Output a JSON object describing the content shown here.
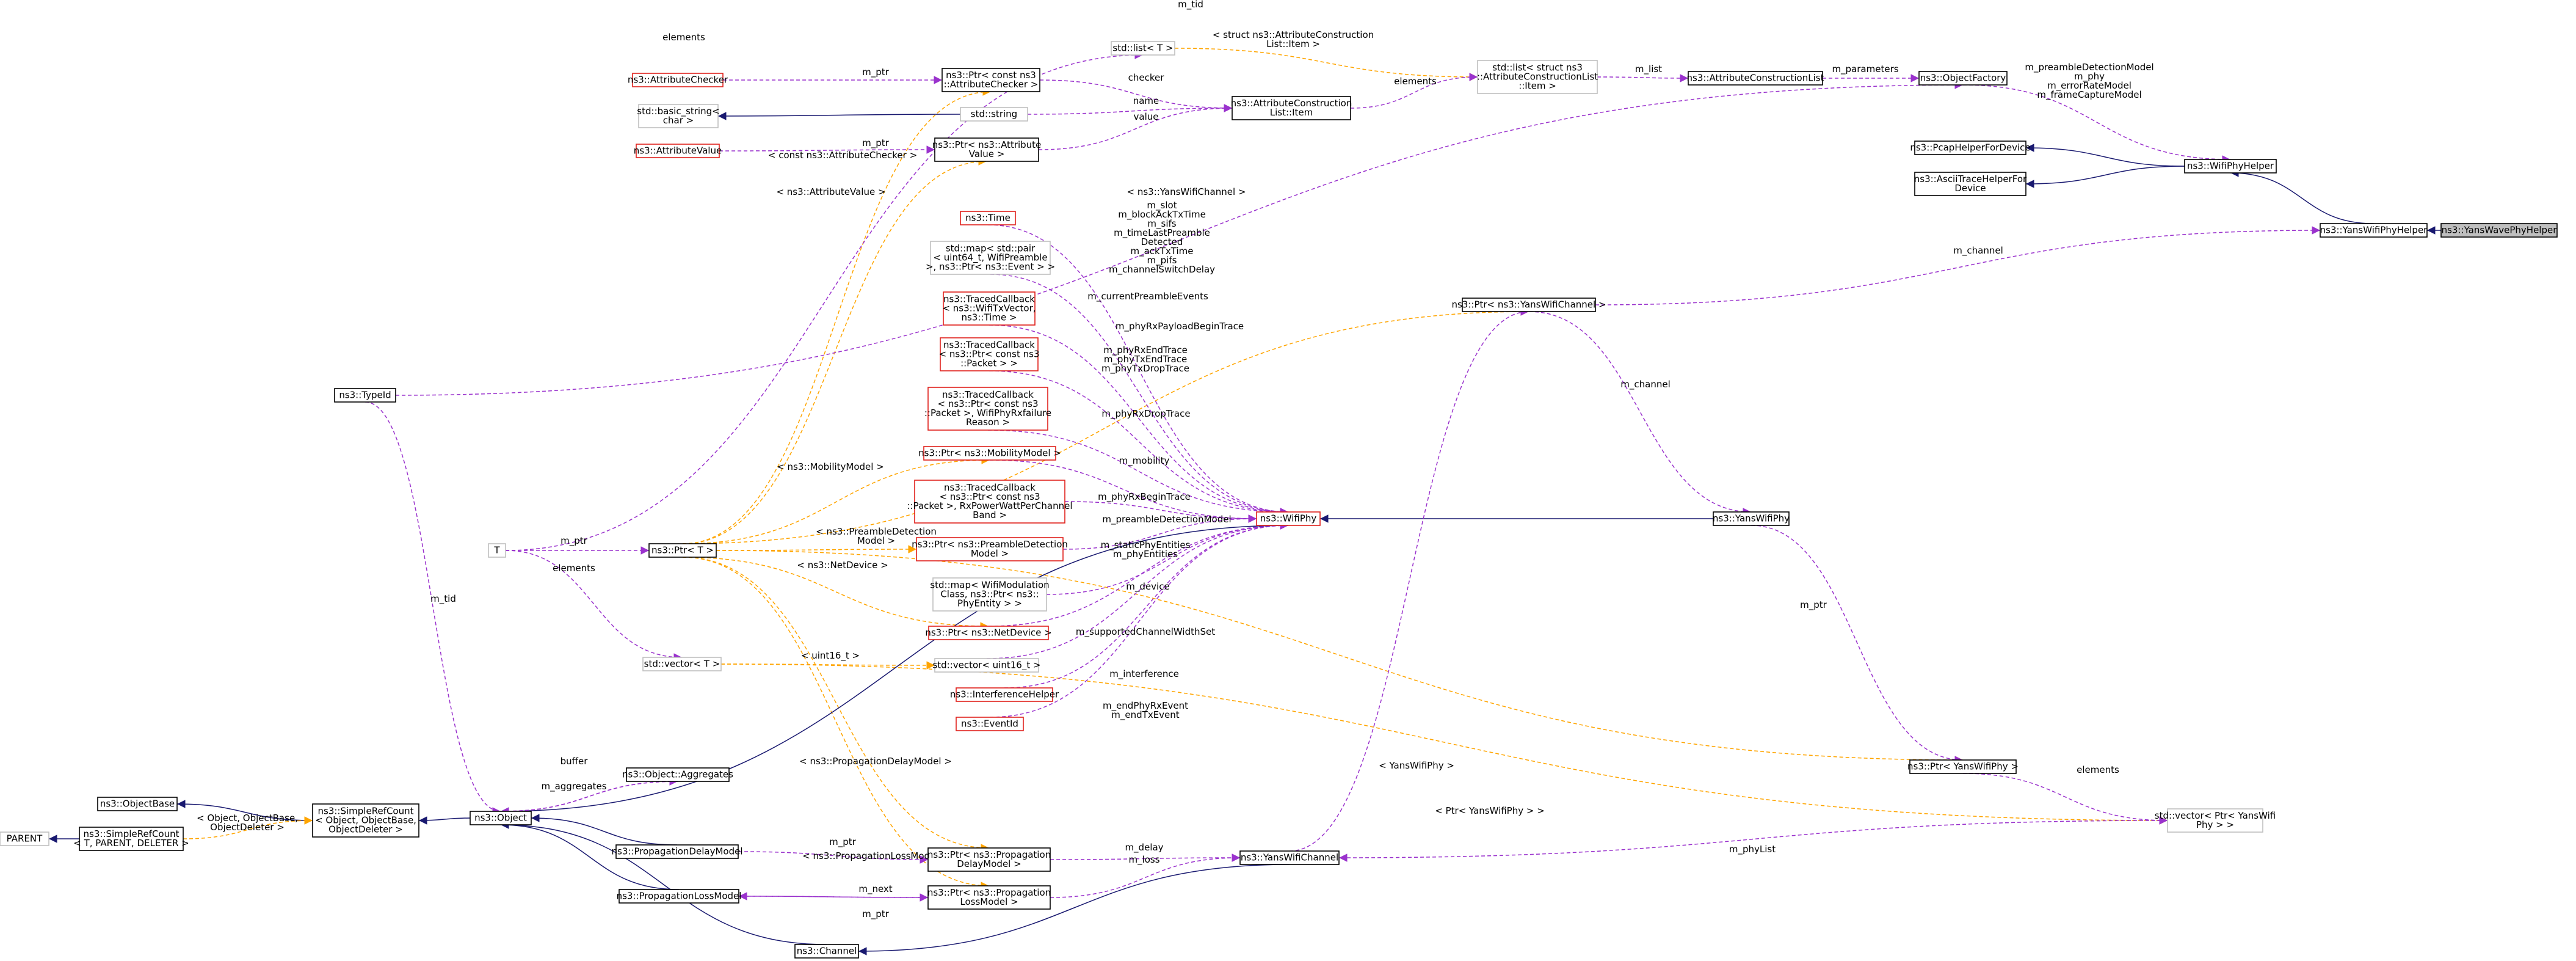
{
  "colors": {
    "inheritance": "#191970",
    "usage": "#9a32cd",
    "template": "#ffa500",
    "documented_border": "#000000",
    "undocumented_border": "#e0201b",
    "external_border": "#bfbfbf",
    "focus_fill": "#bfbfbf"
  },
  "nodes": [
    {
      "id": "focus",
      "lines": [
        "ns3::YansWavePhyHelper"
      ],
      "style": "focus"
    },
    {
      "id": "yanswifiphyhelper",
      "lines": [
        "ns3::YansWifiPhyHelper"
      ],
      "style": "black"
    },
    {
      "id": "wifiphyhelper",
      "lines": [
        "ns3::WifiPhyHelper"
      ],
      "style": "black"
    },
    {
      "id": "pcaphelper",
      "lines": [
        "ns3::PcapHelperForDevice"
      ],
      "style": "black"
    },
    {
      "id": "asciihelper",
      "lines": [
        "ns3::AsciiTraceHelperFor",
        "Device"
      ],
      "style": "black"
    },
    {
      "id": "objectfactory",
      "lines": [
        "ns3::ObjectFactory"
      ],
      "style": "black"
    },
    {
      "id": "attrlist",
      "lines": [
        "ns3::AttributeConstructionList"
      ],
      "style": "black"
    },
    {
      "id": "stdlistitem",
      "lines": [
        "std::list< struct ns3",
        "::AttributeConstructionList",
        "::Item >"
      ],
      "style": "gray"
    },
    {
      "id": "stdlistT",
      "lines": [
        "std::list< T >"
      ],
      "style": "gray"
    },
    {
      "id": "attritem",
      "lines": [
        "ns3::AttributeConstruction",
        "List::Item"
      ],
      "style": "black"
    },
    {
      "id": "ptrchecker",
      "lines": [
        "ns3::Ptr< const ns3",
        "::AttributeChecker >"
      ],
      "style": "black"
    },
    {
      "id": "attrchecker",
      "lines": [
        "ns3::AttributeChecker"
      ],
      "style": "red"
    },
    {
      "id": "stdstring",
      "lines": [
        "std::string"
      ],
      "style": "gray"
    },
    {
      "id": "basicstring",
      "lines": [
        "std::basic_string<",
        "char >"
      ],
      "style": "gray"
    },
    {
      "id": "ptrattrvalue",
      "lines": [
        "ns3::Ptr< ns3::Attribute",
        "Value >"
      ],
      "style": "black"
    },
    {
      "id": "attrvalue",
      "lines": [
        "ns3::AttributeValue"
      ],
      "style": "red"
    },
    {
      "id": "typeid",
      "lines": [
        "ns3::TypeId"
      ],
      "style": "black"
    },
    {
      "id": "T",
      "lines": [
        "T"
      ],
      "style": "gray"
    },
    {
      "id": "ptrT",
      "lines": [
        "ns3::Ptr< T >"
      ],
      "style": "black"
    },
    {
      "id": "time",
      "lines": [
        "ns3::Time"
      ],
      "style": "red"
    },
    {
      "id": "stdmap1",
      "lines": [
        "std::map< std::pair",
        "< uint64_t, WifiPreamble",
        ">, ns3::Ptr< ns3::Event > >"
      ],
      "style": "gray"
    },
    {
      "id": "tc1",
      "lines": [
        "ns3::TracedCallback",
        "< ns3::WifiTxVector,",
        "ns3::Time >"
      ],
      "style": "red"
    },
    {
      "id": "tc2",
      "lines": [
        "ns3::TracedCallback",
        "< ns3::Ptr< const ns3",
        "::Packet > >"
      ],
      "style": "red"
    },
    {
      "id": "tc3",
      "lines": [
        "ns3::TracedCallback",
        "< ns3::Ptr< const ns3",
        "::Packet >, WifiPhyRxfailure",
        "Reason >"
      ],
      "style": "red"
    },
    {
      "id": "ptrmobility",
      "lines": [
        "ns3::Ptr< ns3::MobilityModel >"
      ],
      "style": "red"
    },
    {
      "id": "tc4",
      "lines": [
        "ns3::TracedCallback",
        "< ns3::Ptr< const ns3",
        "::Packet >, RxPowerWattPerChannel",
        "Band >"
      ],
      "style": "red"
    },
    {
      "id": "ptrpreamble",
      "lines": [
        "ns3::Ptr< ns3::PreambleDetection",
        "Model >"
      ],
      "style": "red"
    },
    {
      "id": "stdmap2",
      "lines": [
        "std::map< WifiModulation",
        "Class, ns3::Ptr< ns3::",
        "PhyEntity > >"
      ],
      "style": "gray"
    },
    {
      "id": "ptrnetdevice",
      "lines": [
        "ns3::Ptr< ns3::NetDevice >"
      ],
      "style": "red"
    },
    {
      "id": "vecuint16",
      "lines": [
        "std::vector< uint16_t >"
      ],
      "style": "gray"
    },
    {
      "id": "interference",
      "lines": [
        "ns3::InterferenceHelper"
      ],
      "style": "red"
    },
    {
      "id": "eventid",
      "lines": [
        "ns3::EventId"
      ],
      "style": "red"
    },
    {
      "id": "wifiphy",
      "lines": [
        "ns3::WifiPhy"
      ],
      "style": "red"
    },
    {
      "id": "yanswifiphy",
      "lines": [
        "ns3::YansWifiPhy"
      ],
      "style": "black"
    },
    {
      "id": "ptryanschannel",
      "lines": [
        "ns3::Ptr< ns3::YansWifiChannel >"
      ],
      "style": "black"
    },
    {
      "id": "ptryansphy",
      "lines": [
        "ns3::Ptr< YansWifiPhy >"
      ],
      "style": "black"
    },
    {
      "id": "vecptryans",
      "lines": [
        "std::vector< Ptr< YansWifi",
        "Phy > >"
      ],
      "style": "gray"
    },
    {
      "id": "stdvectorT",
      "lines": [
        "std::vector< T >"
      ],
      "style": "gray"
    },
    {
      "id": "aggregates",
      "lines": [
        "ns3::Object::Aggregates"
      ],
      "style": "black"
    },
    {
      "id": "objectbase",
      "lines": [
        "ns3::ObjectBase"
      ],
      "style": "black"
    },
    {
      "id": "simplerefcount",
      "lines": [
        "ns3::SimpleRefCount",
        "< Object, ObjectBase,",
        "ObjectDeleter >"
      ],
      "style": "black"
    },
    {
      "id": "simplerefcountT",
      "lines": [
        "ns3::SimpleRefCount",
        "< T, PARENT, DELETER >"
      ],
      "style": "black"
    },
    {
      "id": "parent",
      "lines": [
        "PARENT"
      ],
      "style": "gray"
    },
    {
      "id": "object",
      "lines": [
        "ns3::Object"
      ],
      "style": "black"
    },
    {
      "id": "propdelay",
      "lines": [
        "ns3::PropagationDelayModel"
      ],
      "style": "black"
    },
    {
      "id": "proploss",
      "lines": [
        "ns3::PropagationLossModel"
      ],
      "style": "black"
    },
    {
      "id": "ptrpropdelay",
      "lines": [
        "ns3::Ptr< ns3::Propagation",
        "DelayModel >"
      ],
      "style": "black"
    },
    {
      "id": "ptrproploss",
      "lines": [
        "ns3::Ptr< ns3::Propagation",
        "LossModel >"
      ],
      "style": "black"
    },
    {
      "id": "yanschannel",
      "lines": [
        "ns3::YansWifiChannel"
      ],
      "style": "black"
    },
    {
      "id": "channel",
      "lines": [
        "ns3::Channel"
      ],
      "style": "black"
    }
  ],
  "edge_labels": [
    {
      "id": "l_mtid_top",
      "lines": [
        "m_tid"
      ]
    },
    {
      "id": "l_elements_top",
      "lines": [
        "elements"
      ]
    },
    {
      "id": "l_struct_item",
      "lines": [
        "< struct ns3::AttributeConstruction",
        "List::Item >"
      ]
    },
    {
      "id": "l_elements_list",
      "lines": [
        "elements"
      ]
    },
    {
      "id": "l_mlist",
      "lines": [
        "m_list"
      ]
    },
    {
      "id": "l_mparams",
      "lines": [
        "m_parameters"
      ]
    },
    {
      "id": "l_preamble_group",
      "lines": [
        "m_preambleDetectionModel",
        "m_phy",
        "m_errorRateModel",
        "m_frameCaptureModel"
      ]
    },
    {
      "id": "l_mptr_checker",
      "lines": [
        "m_ptr"
      ]
    },
    {
      "id": "l_checker",
      "lines": [
        "checker"
      ]
    },
    {
      "id": "l_name",
      "lines": [
        "name"
      ]
    },
    {
      "id": "l_value",
      "lines": [
        "value"
      ]
    },
    {
      "id": "l_mptr_value",
      "lines": [
        "m_ptr"
      ]
    },
    {
      "id": "l_const_checker",
      "lines": [
        "< const ns3::AttributeChecker >"
      ]
    },
    {
      "id": "l_attrvalue_t",
      "lines": [
        "< ns3::AttributeValue >"
      ]
    },
    {
      "id": "l_yanschannel_t",
      "lines": [
        "< ns3::YansWifiChannel >"
      ]
    },
    {
      "id": "l_mchannel_top",
      "lines": [
        "m_channel"
      ]
    },
    {
      "id": "l_slot_group",
      "lines": [
        "m_slot",
        "m_blockAckTxTime",
        "m_sifs",
        "m_timeLastPreamble",
        "Detected",
        "m_ackTxTime",
        "m_pifs",
        "m_channelSwitchDelay"
      ]
    },
    {
      "id": "l_currentpreamble",
      "lines": [
        "m_currentPreambleEvents"
      ]
    },
    {
      "id": "l_phyrxpayload",
      "lines": [
        "m_phyRxPayloadBeginTrace"
      ]
    },
    {
      "id": "l_phyrxend",
      "lines": [
        "m_phyRxEndTrace",
        "m_phyTxEndTrace",
        "m_phyTxDropTrace"
      ]
    },
    {
      "id": "l_phyrxdrop",
      "lines": [
        "m_phyRxDropTrace"
      ]
    },
    {
      "id": "l_mobility_t",
      "lines": [
        "< ns3::MobilityModel >"
      ]
    },
    {
      "id": "l_mmobility",
      "lines": [
        "m_mobility"
      ]
    },
    {
      "id": "l_rxbegin",
      "lines": [
        "m_phyRxBeginTrace"
      ]
    },
    {
      "id": "l_preambledetect",
      "lines": [
        "m_preambleDetectionModel"
      ]
    },
    {
      "id": "l_preamble_t",
      "lines": [
        "< ns3::PreambleDetection",
        "Model >"
      ]
    },
    {
      "id": "l_mptr_T",
      "lines": [
        "m_ptr"
      ]
    },
    {
      "id": "l_elements_vec",
      "lines": [
        "elements"
      ]
    },
    {
      "id": "l_staticphy",
      "lines": [
        "m_staticPhyEntities",
        "m_phyEntities"
      ]
    },
    {
      "id": "l_netdevice_t",
      "lines": [
        "< ns3::NetDevice >"
      ]
    },
    {
      "id": "l_mdevice",
      "lines": [
        "m_device"
      ]
    },
    {
      "id": "l_supportedwidth",
      "lines": [
        "m_supportedChannelWidthSet"
      ]
    },
    {
      "id": "l_uint16_t",
      "lines": [
        "< uint16_t >"
      ]
    },
    {
      "id": "l_minterference",
      "lines": [
        "m_interference"
      ]
    },
    {
      "id": "l_endphy",
      "lines": [
        "m_endPhyRxEvent",
        "m_endTxEvent"
      ]
    },
    {
      "id": "l_mchannel_mid",
      "lines": [
        "m_channel"
      ]
    },
    {
      "id": "l_mptr_yansphy",
      "lines": [
        "m_ptr"
      ]
    },
    {
      "id": "l_mtid_left",
      "lines": [
        "m_tid"
      ]
    },
    {
      "id": "l_buffer",
      "lines": [
        "buffer"
      ]
    },
    {
      "id": "l_maggregates",
      "lines": [
        "m_aggregates"
      ]
    },
    {
      "id": "l_yansphy_t",
      "lines": [
        "< YansWifiPhy >"
      ]
    },
    {
      "id": "l_elements_ptr",
      "lines": [
        "elements"
      ]
    },
    {
      "id": "l_ptryansphy_t",
      "lines": [
        "< Ptr< YansWifiPhy > >"
      ]
    },
    {
      "id": "l_propdelay_t",
      "lines": [
        "< ns3::PropagationDelayModel >"
      ]
    },
    {
      "id": "l_objectbase_t",
      "lines": [
        "< Object, ObjectBase,",
        "ObjectDeleter >"
      ]
    },
    {
      "id": "l_mptr_ch",
      "lines": [
        "m_ptr"
      ]
    },
    {
      "id": "l_proploss_t",
      "lines": [
        "< ns3::PropagationLossModel >"
      ]
    },
    {
      "id": "l_mdelay",
      "lines": [
        "m_delay"
      ]
    },
    {
      "id": "l_mloss",
      "lines": [
        "m_loss"
      ]
    },
    {
      "id": "l_mnext",
      "lines": [
        "m_next"
      ]
    },
    {
      "id": "l_mptr_loss",
      "lines": [
        "m_ptr"
      ]
    },
    {
      "id": "l_mphylist",
      "lines": [
        "m_phyList"
      ]
    }
  ]
}
